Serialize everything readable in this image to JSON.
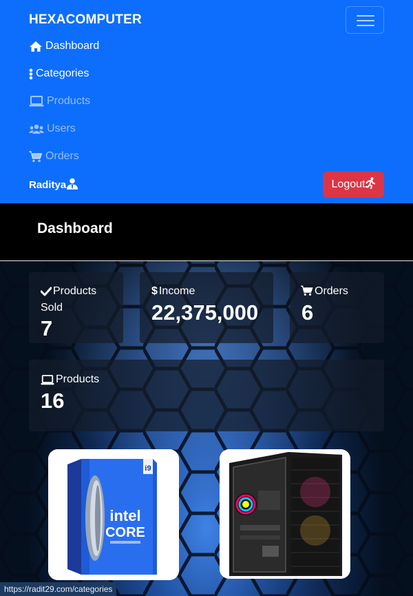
{
  "brand": "HEXACOMPUTER",
  "nav": {
    "toggler_icon": "hamburger-icon",
    "items": [
      {
        "label": "Dashboard",
        "icon": "home-icon",
        "active": true
      },
      {
        "label": "Categories",
        "icon": "ellipsis-vertical-icon",
        "active": true
      },
      {
        "label": "Products",
        "icon": "laptop-icon",
        "active": false
      },
      {
        "label": "Users",
        "icon": "users-icon",
        "active": false
      },
      {
        "label": "Orders",
        "icon": "cart-icon",
        "active": false
      }
    ],
    "user_name": "Raditya",
    "user_icon": "user-tie-icon",
    "logout_label": "Logout",
    "logout_icon": "running-icon"
  },
  "page_title": "Dashboard",
  "stats": [
    {
      "label": "Products Sold",
      "label_line1": "Products",
      "label_line2": "Sold",
      "value": "7",
      "icon": "check-icon"
    },
    {
      "label": "Income",
      "value": "22,375,000",
      "icon": "dollar-icon"
    },
    {
      "label": "Orders",
      "value": "6",
      "icon": "cart-icon"
    },
    {
      "label": "Products",
      "value": "16",
      "icon": "laptop-icon"
    }
  ],
  "products": [
    {
      "name": "Intel Core i9 processor box"
    },
    {
      "name": "PC case with RGB fans"
    }
  ],
  "status_url": "https://radit29.com/categories",
  "colors": {
    "navbar": "#0d6efd",
    "logout": "#dc3545",
    "card_bg": "rgba(20,28,42,0.72)"
  }
}
